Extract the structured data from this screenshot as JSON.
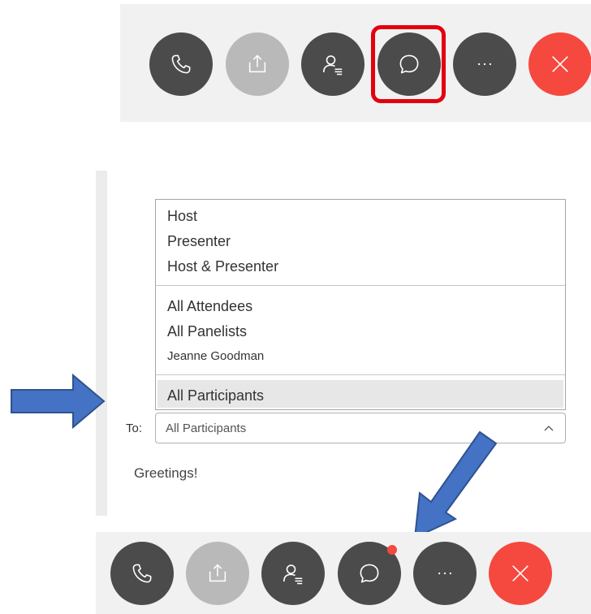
{
  "toolbar_top": {
    "buttons": [
      {
        "icon": "phone-icon",
        "kind": "dark"
      },
      {
        "icon": "share-icon",
        "kind": "disabled"
      },
      {
        "icon": "participants-icon",
        "kind": "dark"
      },
      {
        "icon": "chat-icon",
        "kind": "dark",
        "highlighted": true
      },
      {
        "icon": "more-icon",
        "kind": "dark"
      },
      {
        "icon": "close-icon",
        "kind": "red"
      }
    ]
  },
  "chat": {
    "dropdown": {
      "group1": [
        "Host",
        "Presenter",
        "Host & Presenter"
      ],
      "group2": [
        "All Attendees",
        "All Panelists",
        "Jeanne Goodman"
      ],
      "selected": "All Participants"
    },
    "to_label": "To:",
    "to_value": "All Participants",
    "message": "Greetings!"
  },
  "toolbar_bottom": {
    "buttons": [
      {
        "icon": "phone-icon",
        "kind": "dark"
      },
      {
        "icon": "share-icon",
        "kind": "disabled"
      },
      {
        "icon": "participants-icon",
        "kind": "dark"
      },
      {
        "icon": "chat-icon",
        "kind": "dark",
        "notification": true
      },
      {
        "icon": "more-icon",
        "kind": "dark"
      },
      {
        "icon": "close-icon",
        "kind": "red"
      }
    ]
  },
  "colors": {
    "button_dark": "#4b4b4b",
    "button_disabled": "#b9b9b9",
    "button_end": "#f5483f",
    "highlight_box": "#e3000f",
    "annotation_arrow": "#4472c4"
  }
}
